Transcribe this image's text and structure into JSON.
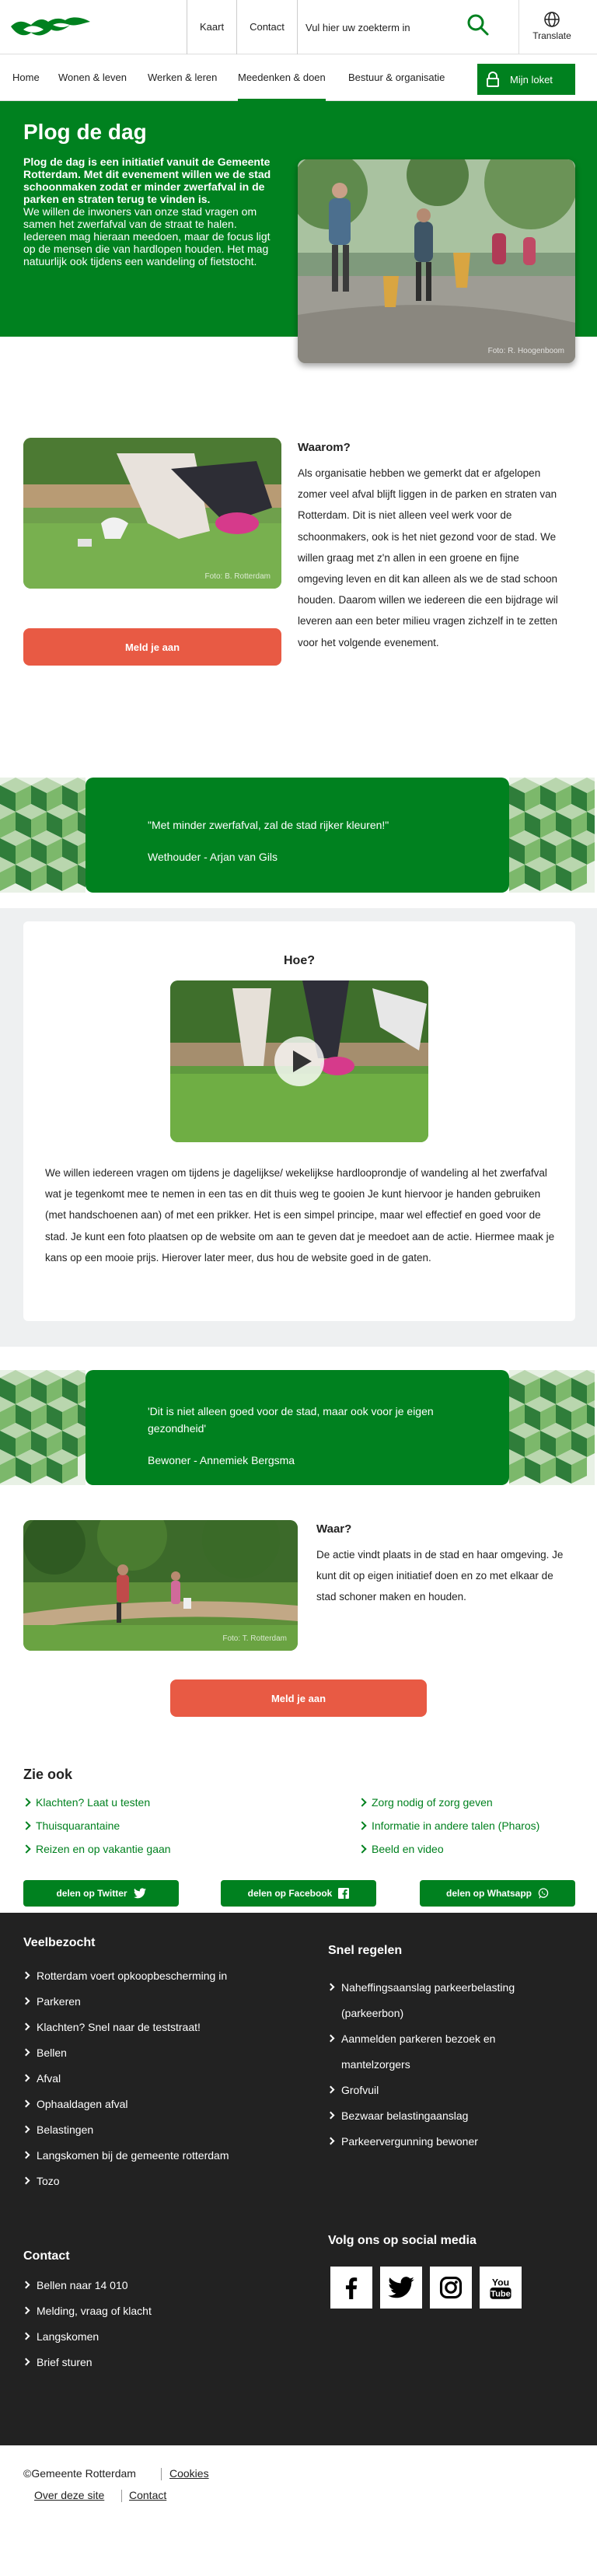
{
  "header": {
    "nav_links": [
      "Kaart",
      "Contact"
    ],
    "search_placeholder": "Vul hier uw zoekterm in",
    "translate_label": "Translate"
  },
  "mainnav": {
    "items": [
      "Home",
      "Wonen & leven",
      "Werken & leren",
      "Meedenken & doen",
      "Bestuur & organisatie"
    ],
    "active": "Meedenken & doen",
    "mijn_loket": "Mijn loket"
  },
  "hero": {
    "title": "Plog de dag",
    "intro_bold": "Plog de dag is een initiatief vanuit de Gemeente Rotterdam. Met dit evenement willen we de stad schoonmaken zodat er minder zwerfafval in de parken en straten terug te vinden is.",
    "intro": "We willen de inwoners van onze stad vragen om samen het zwerfafval van de straat te halen. Iedereen mag hieraan meedoen, maar de focus ligt op de mensen die van hardlopen houden. Het mag natuurlijk ook tijdens een wandeling of fietstocht.",
    "photo_credit": "Foto: R. Hoogenboom"
  },
  "waarom": {
    "heading": "Waarom?",
    "text": "Als organisatie hebben we gemerkt dat er afgelopen zomer veel afval blijft liggen in de parken en straten van Rotterdam. Dit is niet alleen veel werk voor de schoonmakers, ook is het niet gezond voor de stad. We willen graag met z'n allen in een groene en fijne omgeving leven en dit kan alleen als we de stad schoon houden. Daarom willen we iedereen die een bijdrage wil leveren aan een beter milieu vragen zichzelf in te zetten voor het volgende evenement.",
    "photo_credit": "Foto: B. Rotterdam",
    "button": "Meld je aan"
  },
  "quote1": {
    "text": "\"Met minder zwerfafval, zal de stad rijker kleuren!\"",
    "author": "Wethouder - Arjan van Gils"
  },
  "hoe": {
    "heading": "Hoe?",
    "text": "We willen iedereen vragen om tijdens je dagelijkse/ wekelijkse hardlooprondje of wandeling al het zwerfafval wat je tegenkomt mee te nemen in een tas en dit thuis weg te gooien Je kunt hiervoor je handen gebruiken (met handschoenen aan) of met een prikker. Het is een simpel principe, maar wel effectief en goed voor de stad. Je kunt een foto plaatsen op de website om aan te geven dat je meedoet aan de actie. Hiermee maak je kans op een mooie prijs. Hierover later meer, dus hou de website goed in de gaten."
  },
  "quote2": {
    "text": "'Dit is niet alleen goed voor de stad, maar ook voor je eigen gezondheid'",
    "author": "Bewoner - Annemiek Bergsma"
  },
  "waar": {
    "heading": "Waar?",
    "text": "De actie vindt plaats in de stad en haar omgeving. Je kunt dit op eigen initiatief doen en zo met elkaar de stad schoner maken en houden.",
    "photo_credit": "Foto: T. Rotterdam",
    "button": "Meld je aan"
  },
  "zie_ook": {
    "heading": "Zie ook",
    "left": [
      "Klachten? Laat u testen",
      "Thuisquarantaine",
      "Reizen en op vakantie gaan"
    ],
    "right": [
      "Zorg nodig of zorg geven",
      "Informatie in andere talen (Pharos)",
      "Beeld en video"
    ]
  },
  "share": {
    "twitter": "delen op Twitter",
    "facebook": "delen op Facebook",
    "whatsapp": "delen op Whatsapp"
  },
  "footer": {
    "veelbezocht_heading": "Veelbezocht",
    "veelbezocht": [
      "Rotterdam voert opkoopbescherming in",
      "Parkeren",
      "Klachten? Snel naar de teststraat!",
      "Bellen",
      "Afval",
      "Ophaaldagen afval",
      "Belastingen",
      "Langskomen bij de gemeente rotterdam",
      "Tozo"
    ],
    "snel_heading": "Snel regelen",
    "snel": [
      "Naheffingsaanslag parkeerbelasting (parkeerbon)",
      "Aanmelden parkeren bezoek en mantelzorgers",
      "Grofvuil",
      "Bezwaar belastingaanslag",
      "Parkeervergunning bewoner"
    ],
    "contact_heading": "Contact",
    "contact": [
      "Bellen naar 14 010",
      "Melding, vraag of klacht",
      "Langskomen",
      "Brief sturen"
    ],
    "social_heading": "Volg ons op social media",
    "social_icons": [
      "facebook-icon",
      "twitter-icon",
      "instagram-icon",
      "youtube-icon"
    ]
  },
  "bottom": {
    "copyright": "©Gemeente Rotterdam",
    "cookies": "Cookies",
    "over": "Over deze site",
    "contact": "Contact"
  },
  "colors": {
    "brand_green": "#00811f",
    "button_red": "#e85a44",
    "footer_bg": "#222222"
  }
}
